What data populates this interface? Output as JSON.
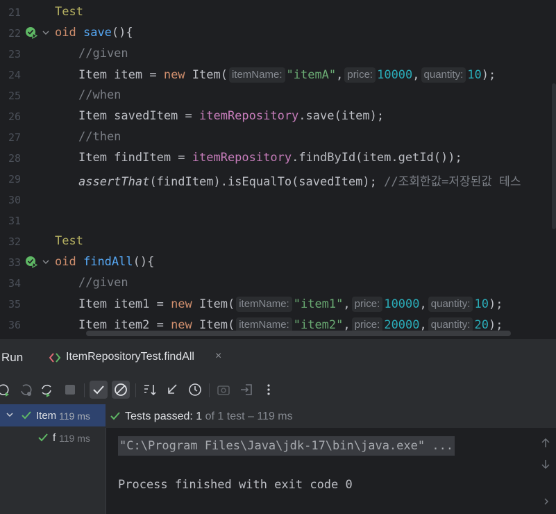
{
  "editor": {
    "line_numbers": [
      "21",
      "22",
      "23",
      "24",
      "25",
      "26",
      "27",
      "28",
      "29",
      "30",
      "31",
      "32",
      "33",
      "34",
      "35",
      "36"
    ],
    "l21": {
      "ann": "Test"
    },
    "l22": {
      "kw": "oid",
      "fn": "save",
      "rest": "(){"
    },
    "l23": {
      "cmt": "//given"
    },
    "l24": {
      "type": "Item item = ",
      "new": "new",
      "ctor": " Item(",
      "hint_name": "itemName:",
      "str": "\"itemA\"",
      "comma1": ",",
      "hint_price": "price:",
      "num_price": "10000",
      "comma2": ",",
      "hint_qty": "quantity:",
      "num_qty": "10",
      "end": ");"
    },
    "l25": {
      "cmt": "//when"
    },
    "l26": {
      "pre": "Item savedItem = ",
      "field": "itemRepository",
      "post": ".save(item);"
    },
    "l27": {
      "cmt": "//then"
    },
    "l28": {
      "pre": "Item findItem = ",
      "field": "itemRepository",
      "post": ".findById(item.getId());"
    },
    "l29": {
      "italic": "assertThat",
      "post": "(findItem).isEqualTo(savedItem); ",
      "cmt": "//조회한값=저장된값 테스"
    },
    "l32": {
      "ann": "Test"
    },
    "l33": {
      "kw": "oid",
      "fn": "findAll",
      "rest": "(){"
    },
    "l34": {
      "cmt": "//given"
    },
    "l35": {
      "type": "Item item1 = ",
      "new": "new",
      "ctor": " Item(",
      "hint_name": "itemName:",
      "str": "\"item1\"",
      "comma1": ",",
      "hint_price": "price:",
      "num_price": "10000",
      "comma2": ",",
      "hint_qty": "quantity:",
      "num_qty": "10",
      "end": ");"
    },
    "l36": {
      "type": "Item item2 = ",
      "new": "new",
      "ctor": " Item(",
      "hint_name": "itemName:",
      "str": "\"item2\"",
      "comma1": ",",
      "hint_price": "price:",
      "num_price": "20000",
      "comma2": ",",
      "hint_qty": "quantity:",
      "num_qty": "20",
      "end": ");"
    }
  },
  "run_panel": {
    "title": "Run",
    "tab_label": "ItemRepositoryTest.findAll",
    "tab_close": "×",
    "toolbar": [
      "rerun-icon",
      "rerun-failed-icon",
      "toggle-auto-test-icon",
      "stop-icon",
      "show-passed-icon",
      "show-ignored-icon",
      "sort-icon",
      "collapse-icon",
      "history-icon",
      "screenshot-icon",
      "export-icon",
      "more-icon"
    ],
    "tree": [
      {
        "name": "Item",
        "time": "119 ms"
      },
      {
        "name": "f",
        "time": "119 ms"
      }
    ],
    "status": {
      "passed": "Tests passed:",
      "count": "1",
      "of": "of 1 test – 119 ms"
    },
    "console": {
      "cmd": "\"C:\\Program Files\\Java\\jdk-17\\bin\\java.exe\" ...",
      "exit": "Process finished with exit code 0"
    }
  },
  "colors": {
    "editor_bg": "#1e1f22",
    "panel_bg": "#2b2d30",
    "selection": "#2e436e",
    "pass_green": "#5fb865"
  }
}
